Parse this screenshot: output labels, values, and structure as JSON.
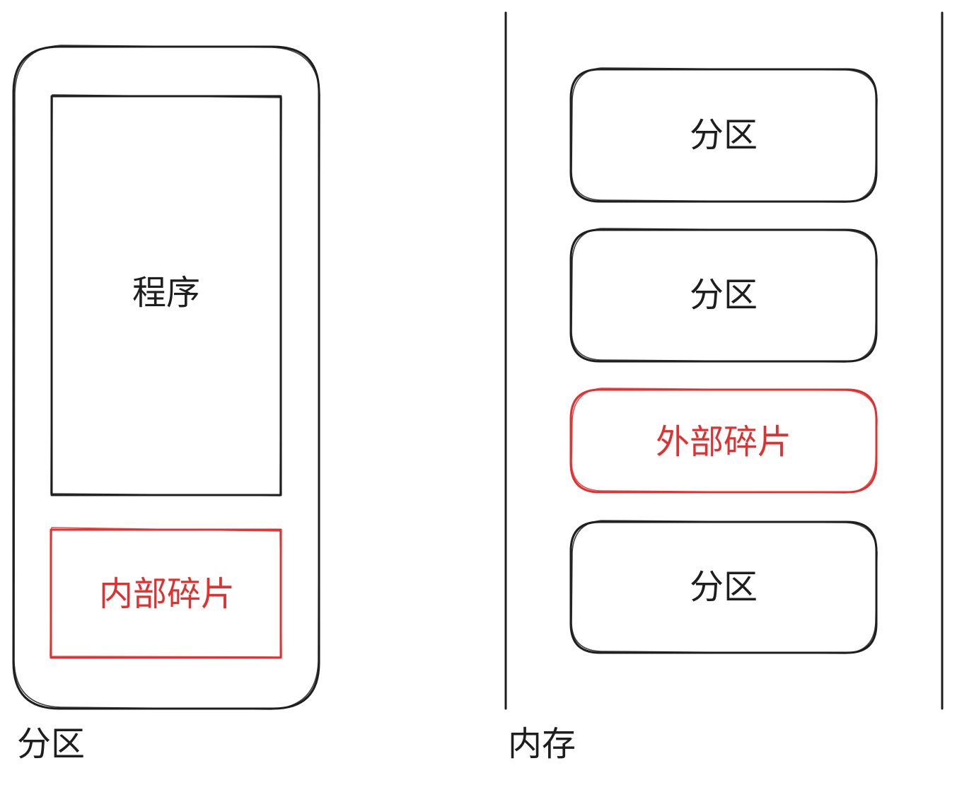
{
  "colors": {
    "stroke": "#1e1e1e",
    "highlight": "#e03131",
    "background": "#ffffff"
  },
  "left_panel": {
    "program_label": "程序",
    "internal_fragment_label": "内部碎片",
    "caption": "分区"
  },
  "right_panel": {
    "blocks": [
      {
        "label": "分区",
        "highlight": false
      },
      {
        "label": "分区",
        "highlight": false
      },
      {
        "label": "外部碎片",
        "highlight": true
      },
      {
        "label": "分区",
        "highlight": false
      }
    ],
    "caption": "内存"
  }
}
